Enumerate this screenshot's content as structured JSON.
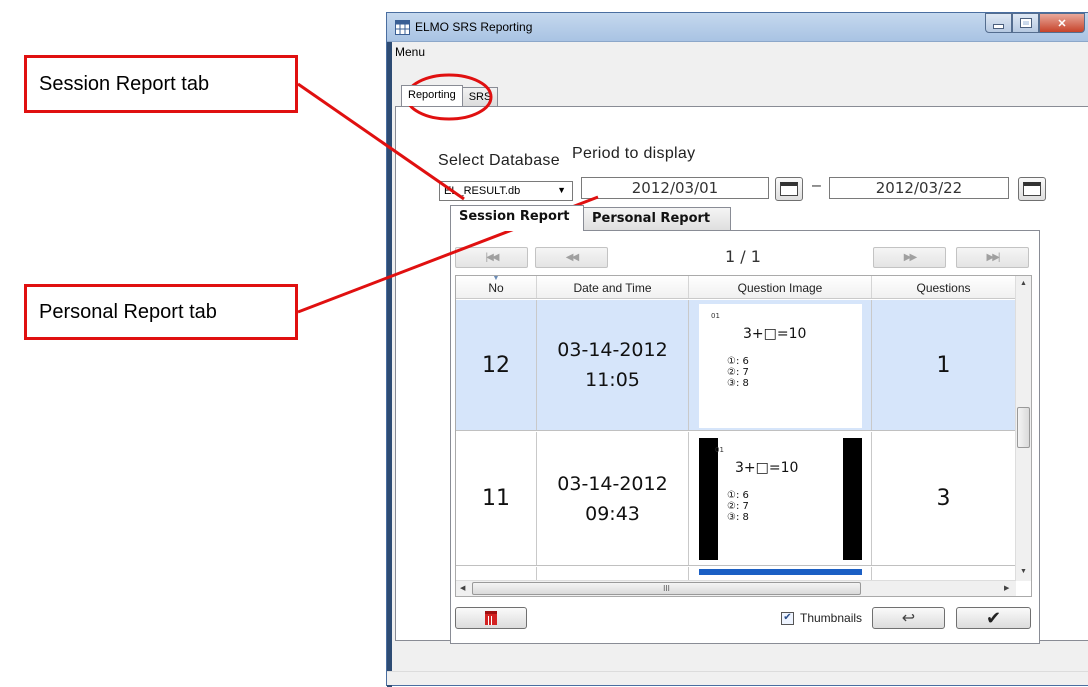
{
  "callouts": {
    "session": "Session Report tab",
    "personal": "Personal Report tab"
  },
  "colors": {
    "callout_border": "#e01010",
    "selected_row": "#d6e5fa",
    "titlebar": "#b6cce8"
  },
  "window": {
    "title": "ELMO SRS Reporting",
    "app_icon": "table-icon"
  },
  "menu": {
    "label": "Menu"
  },
  "outer_tabs": [
    {
      "label": "Reporting",
      "active": true
    },
    {
      "label": "SRS",
      "active": false
    }
  ],
  "filters": {
    "select_db_label": "Select Database",
    "database_value": "EL_RESULT.db",
    "period_label": "Period to display",
    "start_date": "2012/03/01",
    "separator": "–",
    "end_date": "2012/03/22"
  },
  "inner_tabs": [
    {
      "label": "Session Report",
      "active": true
    },
    {
      "label": "Personal Report",
      "active": false
    }
  ],
  "pager": {
    "indicator": "1 / 1"
  },
  "table": {
    "headers": [
      "No",
      "Date and Time",
      "Question Image",
      "Questions"
    ],
    "rows": [
      {
        "no": "12",
        "date": "03-14-2012",
        "time": "11:05",
        "questions": "1",
        "selected": true
      },
      {
        "no": "11",
        "date": "03-14-2012",
        "time": "09:43",
        "questions": "3",
        "selected": false
      }
    ],
    "thumbnail": {
      "qnum": "01",
      "equation": "3+□=10",
      "options": [
        "①: 6",
        "②: 7",
        "③: 8"
      ]
    },
    "hscroll_grip": "III"
  },
  "footer": {
    "thumbnails_label": "Thumbnails",
    "thumbnails_checked": true
  }
}
